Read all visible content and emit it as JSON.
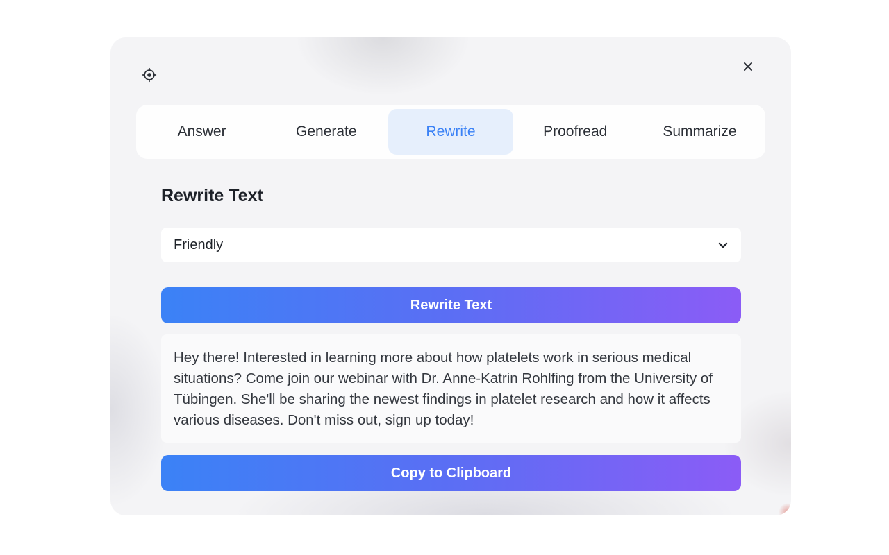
{
  "header": {
    "settings_icon": "settings-icon",
    "close_icon": "close-icon"
  },
  "tabs": [
    {
      "label": "Answer",
      "active": false
    },
    {
      "label": "Generate",
      "active": false
    },
    {
      "label": "Rewrite",
      "active": true
    },
    {
      "label": "Proofread",
      "active": false
    },
    {
      "label": "Summarize",
      "active": false
    }
  ],
  "main": {
    "title": "Rewrite Text",
    "tone_select": {
      "value": "Friendly",
      "icon": "chevron-down-icon"
    },
    "rewrite_button_label": "Rewrite Text",
    "output_text": "Hey there! Interested in learning more about how platelets work in serious medical situations? Come join our webinar with Dr. Anne-Katrin Rohlfing from the University of Tübingen. She'll be sharing the newest findings in platelet research and how it affects various diseases. Don't miss out, sign up today!",
    "copy_button_label": "Copy to Clipboard"
  },
  "colors": {
    "accent": "#3b82f6",
    "gradient_start": "#3b82f6",
    "gradient_end": "#8b5cf6",
    "active_tab_bg": "#e6effc"
  }
}
